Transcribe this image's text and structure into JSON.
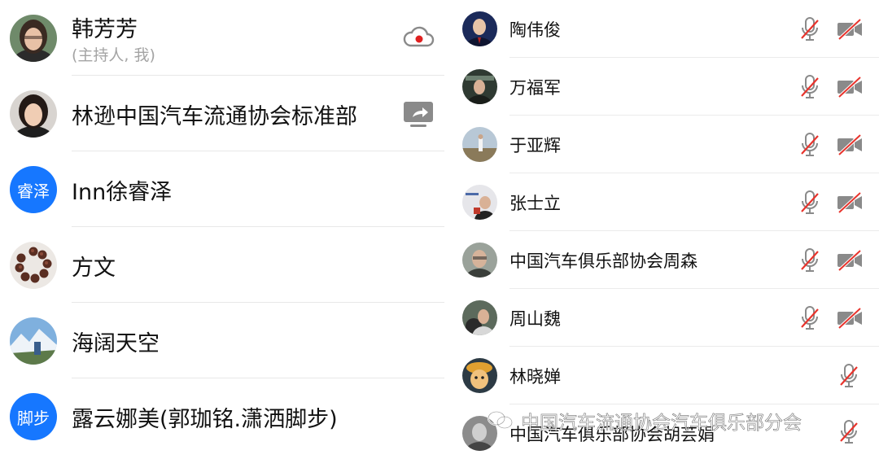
{
  "left_list": [
    {
      "name": "韩芳芳",
      "subtitle": "(主持人, 我)",
      "status_icon": "cloud-record-icon"
    },
    {
      "name": "林逊中国汽车流通协会标准部",
      "status_icon": "screen-share-icon"
    },
    {
      "name": "Inn徐睿泽",
      "avatar_text": "睿泽"
    },
    {
      "name": "方文"
    },
    {
      "name": "海阔天空"
    },
    {
      "name": "露云娜美(郭珈铭.潇洒脚步)",
      "avatar_text": "脚步"
    }
  ],
  "right_list": [
    {
      "name": "陶伟俊",
      "mic_muted": true,
      "camera_off": true
    },
    {
      "name": "万福军",
      "mic_muted": true,
      "camera_off": true
    },
    {
      "name": "于亚辉",
      "mic_muted": true,
      "camera_off": true
    },
    {
      "name": "张士立",
      "mic_muted": true,
      "camera_off": true
    },
    {
      "name": "中国汽车俱乐部协会周森",
      "mic_muted": true,
      "camera_off": true
    },
    {
      "name": "周山魏",
      "mic_muted": true,
      "camera_off": true
    },
    {
      "name": "林晓婵",
      "mic_muted": true
    },
    {
      "name": "中国汽车俱乐部协会胡芸娟",
      "mic_muted": true
    }
  ],
  "watermark": "中国汽车流通协会汽车俱乐部分会",
  "colors": {
    "avatar_blue": "#1677ff",
    "muted_red": "#e8332c",
    "record_red": "#e02020",
    "icon_gray": "#8a8a8a"
  }
}
